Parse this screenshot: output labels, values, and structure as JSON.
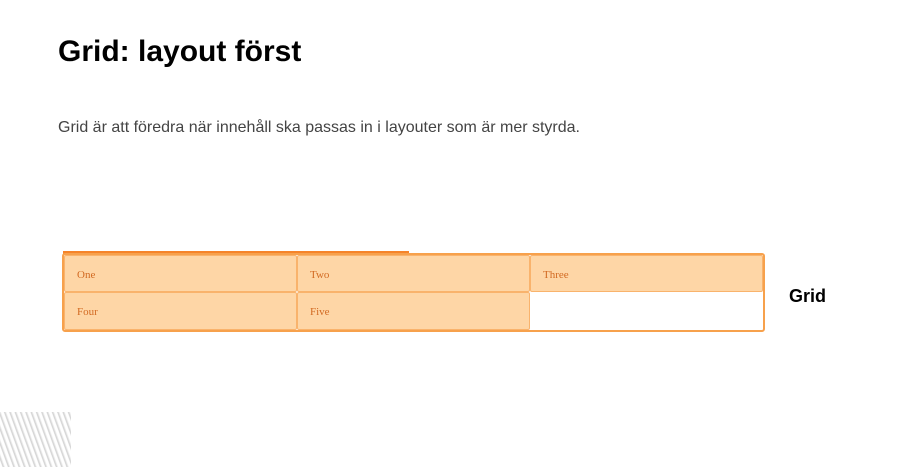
{
  "slide": {
    "title": "Grid: layout först",
    "text": "Grid är att föredra när innehåll ska passas in i layouter som är mer styrda."
  },
  "grid_demo": {
    "items": [
      "One",
      "Two",
      "Three",
      "Four",
      "Five"
    ],
    "label": "Grid"
  },
  "colors": {
    "cell_fill": "#fed6a6",
    "cell_border": "#f9b36c",
    "container_border": "#f7a14c",
    "cell_text": "#d26a22"
  }
}
